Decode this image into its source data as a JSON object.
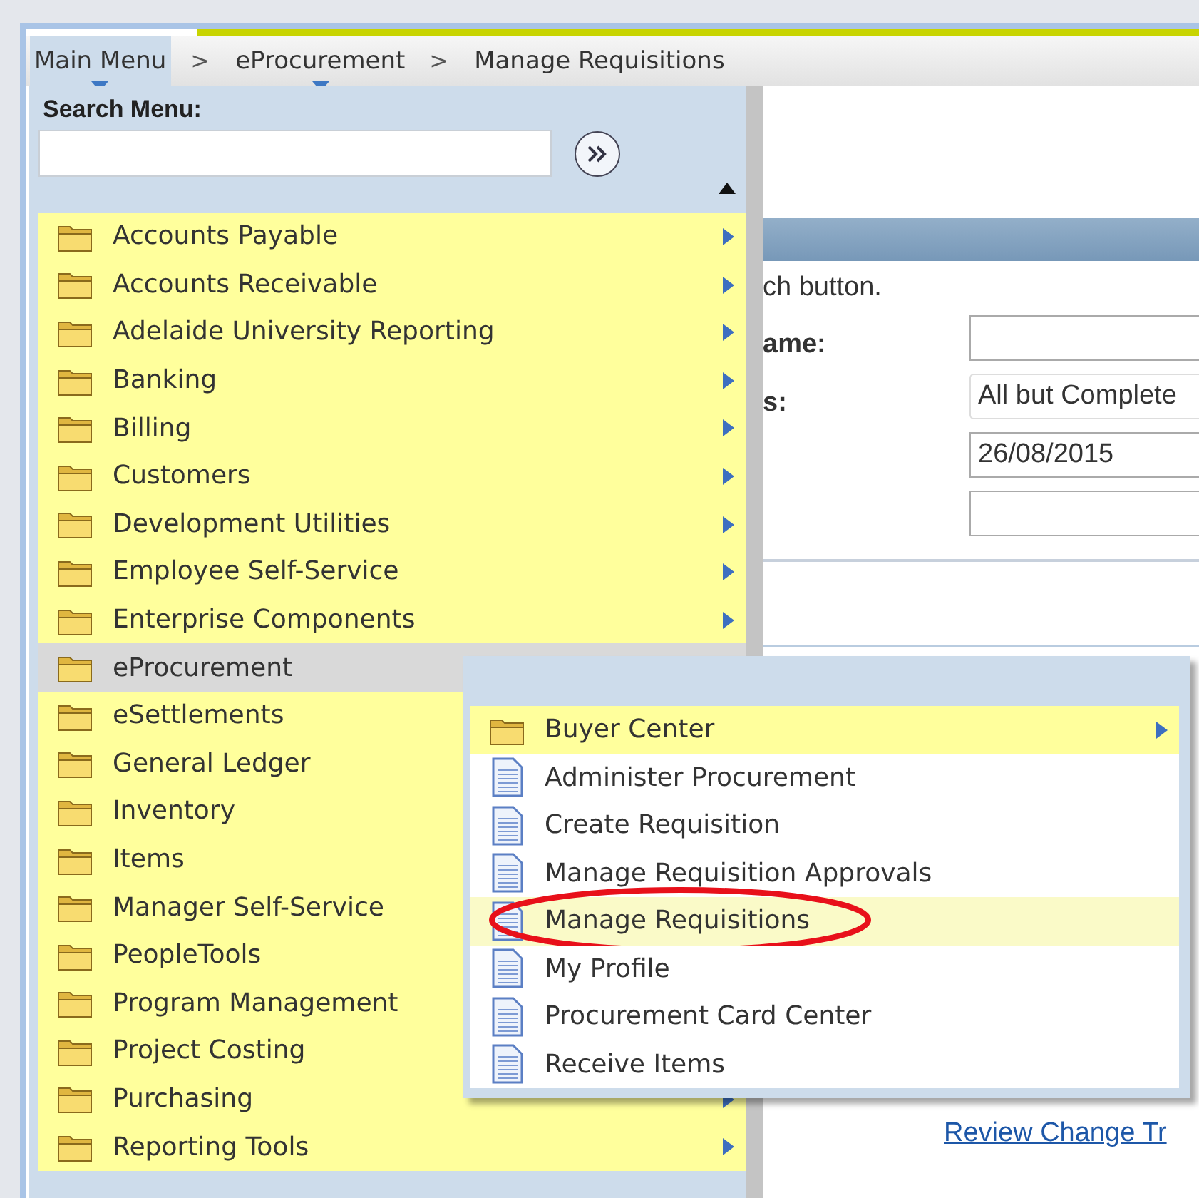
{
  "breadcrumbs": [
    {
      "label": "Main Menu",
      "dropdown": true,
      "active": true
    },
    {
      "label": "eProcurement",
      "dropdown": true,
      "active": false,
      "separator": ">"
    },
    {
      "label": "Manage Requisitions",
      "dropdown": false,
      "active": false,
      "separator": ">"
    }
  ],
  "main_menu": {
    "search_label": "Search Menu:",
    "items": [
      {
        "label": "Accounts Payable",
        "kind": "folder",
        "selected": false
      },
      {
        "label": "Accounts Receivable",
        "kind": "folder",
        "selected": false
      },
      {
        "label": "Adelaide University Reporting",
        "kind": "folder",
        "selected": false
      },
      {
        "label": "Banking",
        "kind": "folder",
        "selected": false
      },
      {
        "label": "Billing",
        "kind": "folder",
        "selected": false
      },
      {
        "label": "Customers",
        "kind": "folder",
        "selected": false
      },
      {
        "label": "Development Utilities",
        "kind": "folder",
        "selected": false
      },
      {
        "label": "Employee Self-Service",
        "kind": "folder",
        "selected": false
      },
      {
        "label": "Enterprise Components",
        "kind": "folder",
        "selected": false
      },
      {
        "label": "eProcurement",
        "kind": "folder",
        "selected": true
      },
      {
        "label": "eSettlements",
        "kind": "folder",
        "selected": false
      },
      {
        "label": "General Ledger",
        "kind": "folder",
        "selected": false
      },
      {
        "label": "Inventory",
        "kind": "folder",
        "selected": false
      },
      {
        "label": "Items",
        "kind": "folder",
        "selected": false
      },
      {
        "label": "Manager Self-Service",
        "kind": "folder",
        "selected": false
      },
      {
        "label": "PeopleTools",
        "kind": "folder",
        "selected": false
      },
      {
        "label": "Program Management",
        "kind": "folder",
        "selected": false
      },
      {
        "label": "Project Costing",
        "kind": "folder",
        "selected": false
      },
      {
        "label": "Purchasing",
        "kind": "folder",
        "selected": false
      },
      {
        "label": "Reporting Tools",
        "kind": "folder",
        "selected": false
      }
    ]
  },
  "submenu": {
    "items": [
      {
        "label": "Buyer Center",
        "kind": "folder",
        "selected": false,
        "circled": false
      },
      {
        "label": "Administer Procurement",
        "kind": "page",
        "selected": false,
        "circled": false
      },
      {
        "label": "Create Requisition",
        "kind": "page",
        "selected": false,
        "circled": false
      },
      {
        "label": "Manage Requisition Approvals",
        "kind": "page",
        "selected": false,
        "circled": false
      },
      {
        "label": "Manage Requisitions",
        "kind": "page",
        "selected": true,
        "circled": true
      },
      {
        "label": "My Profile",
        "kind": "page",
        "selected": false,
        "circled": false
      },
      {
        "label": "Procurement Card Center",
        "kind": "page",
        "selected": false,
        "circled": false
      },
      {
        "label": "Receive Items",
        "kind": "page",
        "selected": false,
        "circled": false
      }
    ]
  },
  "page": {
    "instruction": "ch button.",
    "fields": [
      {
        "label": "ame:",
        "kind": "input"
      },
      {
        "label": "s:",
        "kind": "select",
        "value": "All but Complete"
      },
      {
        "kind": "input",
        "value": "26/08/2015"
      },
      {
        "kind": "input"
      }
    ],
    "link": "Review Change Tr"
  }
}
